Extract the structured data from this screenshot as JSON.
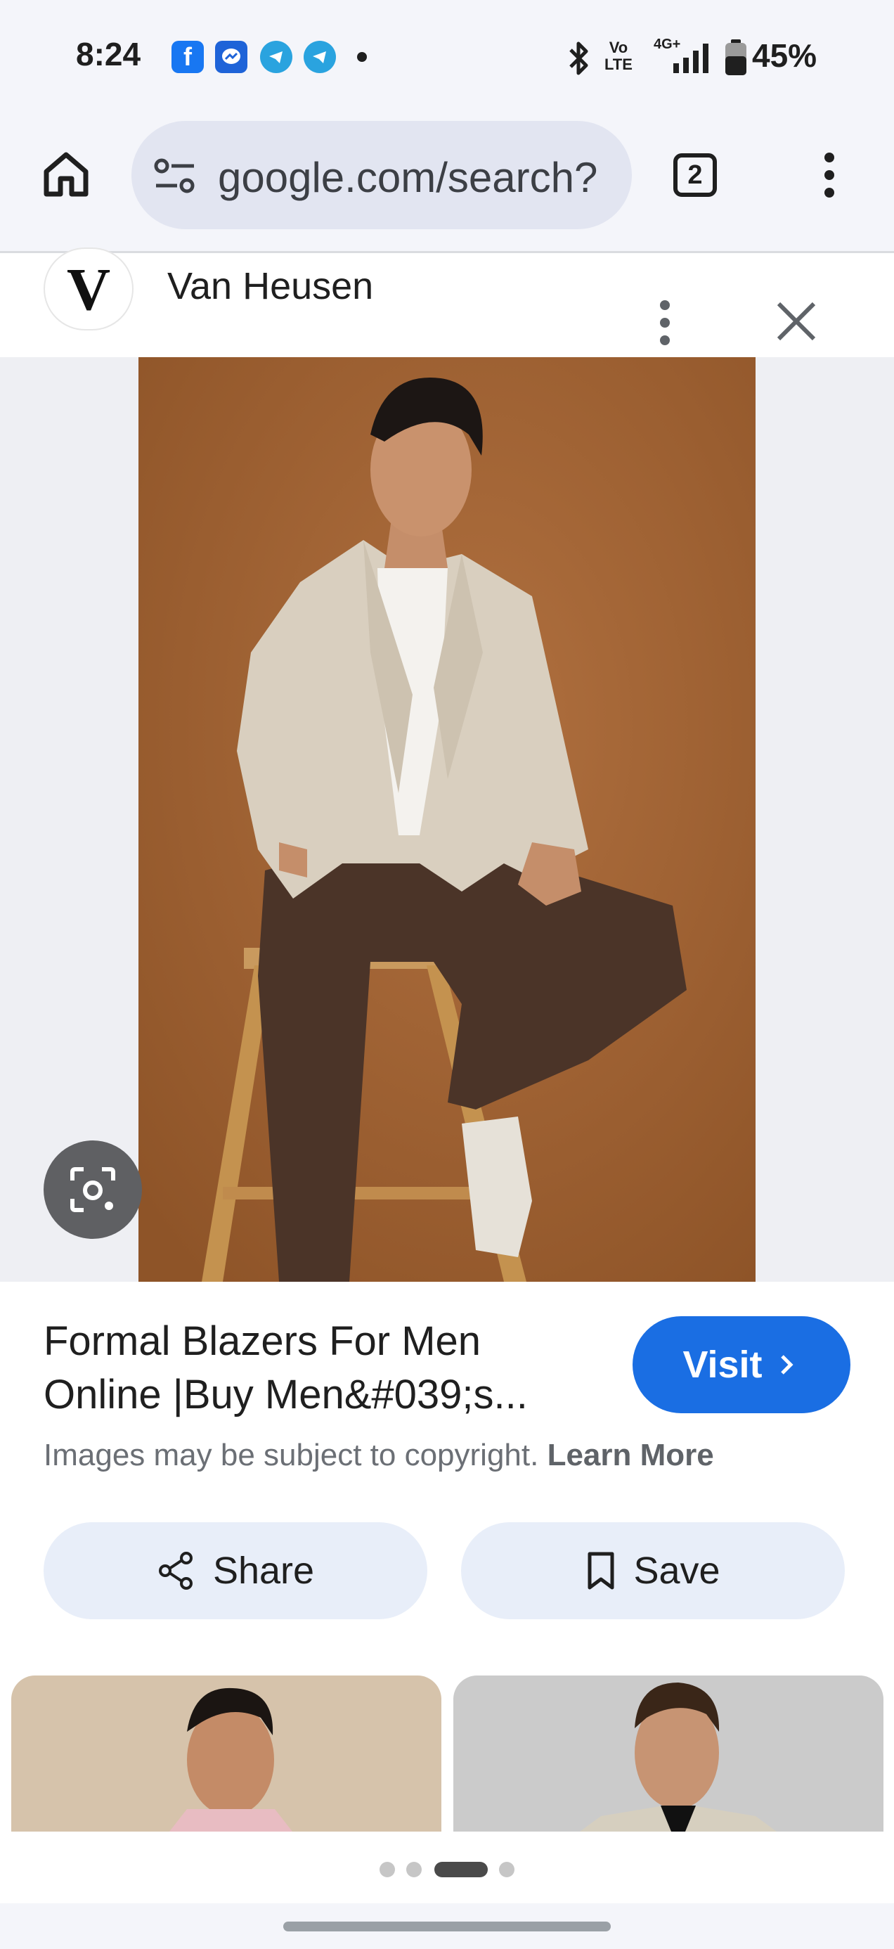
{
  "status_bar": {
    "time": "8:24",
    "battery": "45%",
    "notification_icons": [
      "facebook-icon",
      "messenger-icon",
      "telegram-icon",
      "telegram-icon"
    ],
    "system_icons": [
      "bluetooth-icon",
      "volte-icon",
      "signal-4g-icon",
      "battery-icon"
    ],
    "network_label": "4G+",
    "volte_label_top": "Vo",
    "volte_label_bottom": "LTE"
  },
  "toolbar": {
    "url": "google.com/search?",
    "tab_count": "2",
    "icons": [
      "home-icon",
      "site-settings-icon",
      "more-vert-icon"
    ]
  },
  "source": {
    "logo_letter": "V",
    "name": "Van Heusen"
  },
  "result": {
    "title": "Formal Blazers For Men Online |Buy Men&#039;s...",
    "visit_label": "Visit",
    "copyright_text": "Images may be subject to copyright.",
    "learn_more": "Learn More",
    "share_label": "Share",
    "save_label": "Save"
  },
  "carousel": {
    "dot_count": 4,
    "active_index": 2
  },
  "colors": {
    "accent": "#1a6ee3",
    "chrome_bg": "#f4f5fa",
    "url_pill": "#e2e5f1",
    "action_btn_bg": "#e8eef9",
    "photo_backdrop": "#a8683a"
  }
}
